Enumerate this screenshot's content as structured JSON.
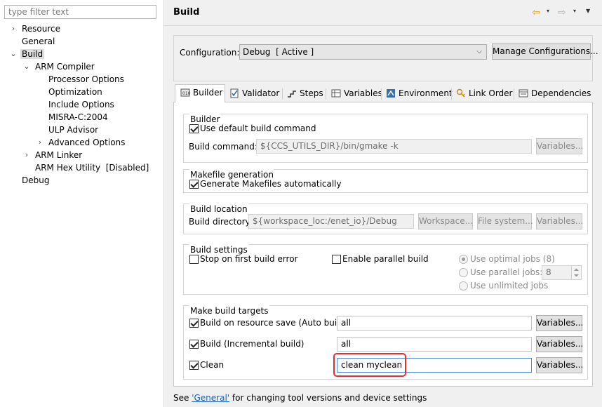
{
  "left": {
    "filter_placeholder": "type filter text",
    "tree": [
      {
        "label": "Resource",
        "chevron": "›"
      },
      {
        "label": "General"
      },
      {
        "label": "Build",
        "chevron": "⌄"
      },
      {
        "label": "ARM Compiler",
        "chevron": "⌄"
      },
      {
        "label": "Processor Options"
      },
      {
        "label": "Optimization"
      },
      {
        "label": "Include Options"
      },
      {
        "label": "MISRA-C:2004"
      },
      {
        "label": "ULP Advisor"
      },
      {
        "label": "Advanced Options",
        "chevron": "›"
      },
      {
        "label": "ARM Linker",
        "chevron": "›"
      },
      {
        "label": "ARM Hex Utility  [Disabled]"
      },
      {
        "label": "Debug"
      }
    ]
  },
  "header": {
    "title": "Build",
    "back_icon": "⇦",
    "forward_icon": "⇨",
    "dropdown_icon": "▾",
    "menu_icon": "▼"
  },
  "config": {
    "label": "Configuration:",
    "value": "Debug  [ Active ]",
    "dropdown_icon": "⌵",
    "manage_button": "Manage Configurations..."
  },
  "tabs": [
    {
      "label": "Builder",
      "active": true
    },
    {
      "label": "Validator"
    },
    {
      "label": "Steps"
    },
    {
      "label": "Variables"
    },
    {
      "label": "Environment"
    },
    {
      "label": "Link Order"
    },
    {
      "label": "Dependencies"
    }
  ],
  "builder": {
    "title": "Builder",
    "use_default_label": "Use default build command",
    "use_default_checked": true,
    "command_label": "Build command:",
    "command_value": "${CCS_UTILS_DIR}/bin/gmake -k",
    "variables_button": "Variables..."
  },
  "makefile": {
    "title": "Makefile generation",
    "generate_label": "Generate Makefiles automatically",
    "generate_checked": true
  },
  "location": {
    "title": "Build location",
    "dir_label": "Build directory:",
    "dir_value": "${workspace_loc:/enet_io}/Debug",
    "workspace_button": "Workspace...",
    "filesystem_button": "File system...",
    "variables_button": "Variables..."
  },
  "settings": {
    "title": "Build settings",
    "stop_label": "Stop on first build error",
    "parallel_label": "Enable parallel build",
    "optimal_label": "Use optimal jobs (8)",
    "parallel_jobs_label": "Use parallel jobs:",
    "parallel_jobs_value": "8",
    "unlimited_label": "Use unlimited jobs"
  },
  "targets": {
    "title": "Make build targets",
    "auto_label": "Build on resource save (Auto build)",
    "auto_value": "all",
    "incremental_label": "Build (Incremental build)",
    "incremental_value": "all",
    "clean_label": "Clean",
    "clean_value": "clean myclean",
    "variables_button": "Variables..."
  },
  "footer": {
    "prefix": "See ",
    "link": "'General'",
    "suffix": " for changing tool versions and device settings"
  },
  "colors": {
    "highlight": "#e0302f",
    "link": "#1a5fb4",
    "selected_bg": "#dddddd"
  }
}
